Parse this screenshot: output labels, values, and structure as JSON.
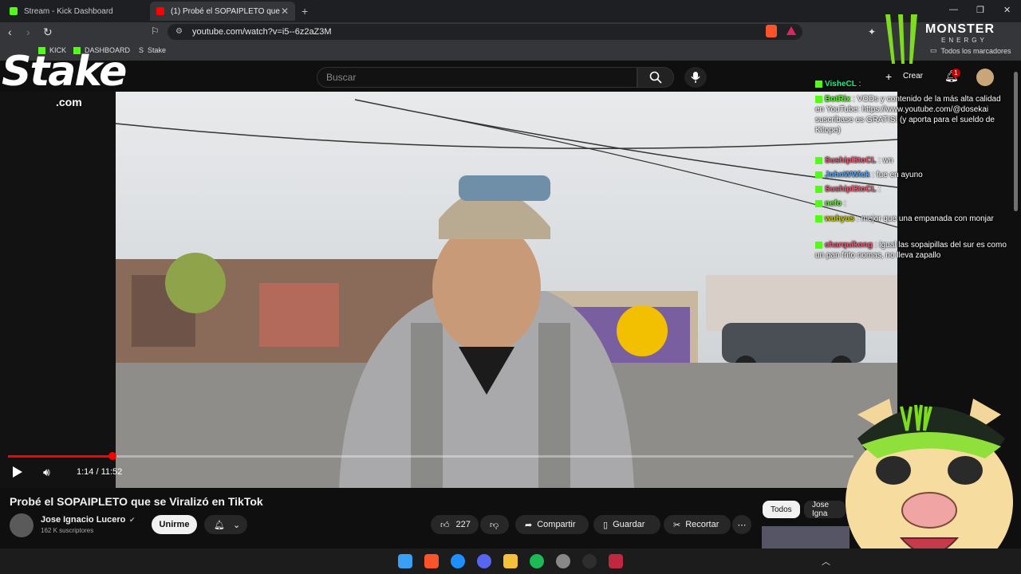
{
  "browser": {
    "tabs": [
      {
        "title": "Stream - Kick Dashboard"
      },
      {
        "title": "(1) Probé el SOPAIPLETO que"
      }
    ],
    "url": "youtube.com/watch?v=i5--6z2aZ3M",
    "bookmarks": [
      "KICK",
      "DASHBOARD",
      "Stake"
    ],
    "all_bookmarks": "Todos los marcadores"
  },
  "youtube": {
    "search_placeholder": "Buscar",
    "create_label": "Crear",
    "notification_count": "1",
    "player": {
      "time": "1:14 / 11:52",
      "progress_fraction": 0.104
    },
    "video_title": "Probé el SOPAIPLETO que se Viralizó en TikTok",
    "channel": "Jose Ignacio Lucero",
    "subscribers": "162 K suscriptores",
    "join_label": "Unirme",
    "likes": "227",
    "share_label": "Compartir",
    "save_label": "Guardar",
    "clip_label": "Recortar",
    "chips": [
      "Todos",
      "Jose Igna"
    ]
  },
  "chat": [
    {
      "user": "VisheCL",
      "text": ":",
      "color": "#00ff7f"
    },
    {
      "user": "BotRix",
      "text": ": VODs y contenido de la más alta calidad en YouTube: https://www.youtube.com/@dosekai suscribase es GRATIS! (y aporta para el sueldo de Kitope)",
      "color": "#53fc18"
    },
    {
      "user": "Sushipl3toCL",
      "text": ": wn",
      "color": "#ff4d6d"
    },
    {
      "user": "JohnWWick",
      "text": ": fue en ayuno",
      "color": "#4da6ff"
    },
    {
      "user": "Sushipl3toCL",
      "text": ":",
      "color": "#ff4d6d"
    },
    {
      "user": "nefo",
      "text": ":",
      "color": "#53fc18"
    },
    {
      "user": "wuhyus",
      "text": ": mejor que una empanada con monjar",
      "color": "#c8c800"
    },
    {
      "user": "charquikong",
      "text": ": igual las sopaipillas del sur es como un pan frito nomas, no lleva zapallo",
      "color": "#ff4d6d"
    }
  ],
  "overlays": {
    "stake_logo": "Stake",
    "stake_domain": ".com",
    "monster_logo": "MONSTER",
    "monster_sub": "ENERGY"
  },
  "colors": {
    "kick_green": "#53fc18",
    "yt_red": "#ff0000"
  }
}
